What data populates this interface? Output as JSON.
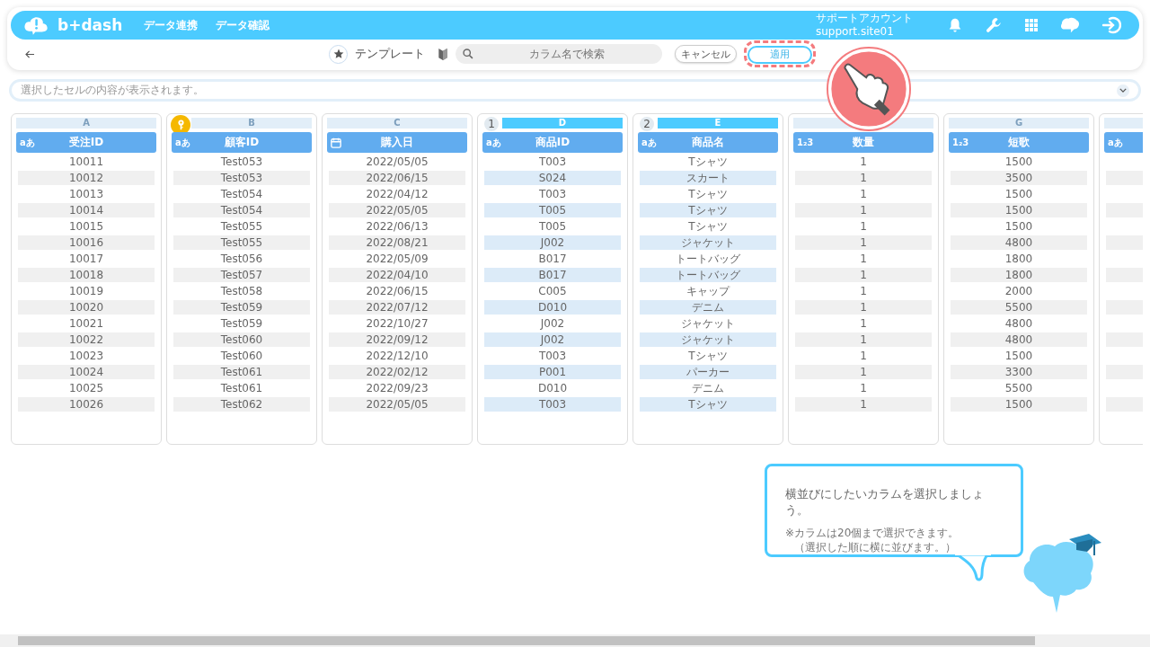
{
  "nav": {
    "logo": "b+dash",
    "links": [
      "データ連携",
      "データ確認"
    ],
    "account": {
      "name": "サポートアカウント",
      "id": "support.site01"
    }
  },
  "toolbar": {
    "title": "テンプレート",
    "search": {
      "placeholder": "カラム名で検索"
    },
    "cancel": "キャンセル",
    "apply": "適用",
    "apply_highlighted": true
  },
  "cell_view": {
    "placeholder": "選択したセルの内容が表示されます。"
  },
  "columns": [
    {
      "letter": "A",
      "kind": "text",
      "type_label": "aあ",
      "name": "受注ID",
      "selected": false,
      "cells": [
        "10011",
        "10012",
        "10013",
        "10014",
        "10015",
        "10016",
        "10017",
        "10018",
        "10019",
        "10020",
        "10021",
        "10022",
        "10023",
        "10024",
        "10025",
        "10026"
      ]
    },
    {
      "letter": "B",
      "kind": "text",
      "type_label": "aあ",
      "name": "顧客ID",
      "key": true,
      "selected": false,
      "cells": [
        "Test053",
        "Test053",
        "Test054",
        "Test054",
        "Test055",
        "Test055",
        "Test056",
        "Test057",
        "Test058",
        "Test059",
        "Test059",
        "Test060",
        "Test060",
        "Test061",
        "Test061",
        "Test062"
      ]
    },
    {
      "letter": "C",
      "kind": "date",
      "name": "購入日",
      "selected": false,
      "cells": [
        "2022/05/05",
        "2022/06/15",
        "2022/04/12",
        "2022/05/05",
        "2022/06/13",
        "2022/08/21",
        "2022/05/09",
        "2022/04/10",
        "2022/06/15",
        "2022/07/12",
        "2022/10/27",
        "2022/09/12",
        "2022/12/10",
        "2022/02/12",
        "2022/09/23",
        "2022/05/05"
      ]
    },
    {
      "letter": "D",
      "kind": "text",
      "type_label": "aあ",
      "name": "商品ID",
      "selected": true,
      "order": "1",
      "cells": [
        "T003",
        "S024",
        "T003",
        "T005",
        "T005",
        "J002",
        "B017",
        "B017",
        "C005",
        "D010",
        "J002",
        "J002",
        "T003",
        "P001",
        "D010",
        "T003"
      ]
    },
    {
      "letter": "E",
      "kind": "text",
      "type_label": "aあ",
      "name": "商品名",
      "selected": true,
      "order": "2",
      "cells": [
        "Tシャツ",
        "スカート",
        "Tシャツ",
        "Tシャツ",
        "Tシャツ",
        "ジャケット",
        "トートバッグ",
        "トートバッグ",
        "キャップ",
        "デニム",
        "ジャケット",
        "ジャケット",
        "Tシャツ",
        "パーカー",
        "デニム",
        "Tシャツ"
      ]
    },
    {
      "kind": "number",
      "type_label": "1₂3",
      "name": "数量",
      "selected": false,
      "cells": [
        "1",
        "1",
        "1",
        "1",
        "1",
        "1",
        "1",
        "1",
        "1",
        "1",
        "1",
        "1",
        "1",
        "1",
        "1",
        "1"
      ]
    },
    {
      "letter": "G",
      "kind": "number",
      "type_label": "1₂3",
      "name": "短歌",
      "selected": false,
      "cells": [
        "1500",
        "3500",
        "1500",
        "1500",
        "1500",
        "4800",
        "1800",
        "1800",
        "2000",
        "5500",
        "4800",
        "4800",
        "1500",
        "3300",
        "5500",
        "1500"
      ]
    },
    {
      "kind": "text",
      "type_label": "aあ",
      "selected": false
    }
  ],
  "guide": {
    "message": "横並びにしたいカラムを選択しましょう。",
    "notes": [
      "※カラムは20個まで選択できます。",
      "（選択した順に横に並びます。）"
    ]
  }
}
